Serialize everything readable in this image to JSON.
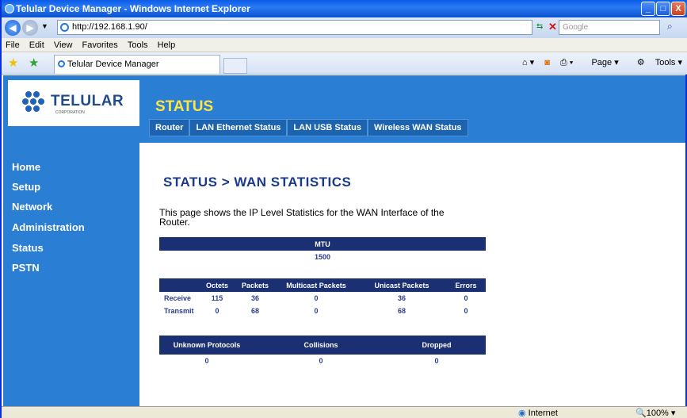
{
  "window": {
    "title": "Telular Device Manager - Windows Internet Explorer",
    "address": "http://192.168.1.90/",
    "search_placeholder": "Google",
    "tab_label": "Telular Device Manager"
  },
  "menu": [
    "File",
    "Edit",
    "View",
    "Favorites",
    "Tools",
    "Help"
  ],
  "toolbar": {
    "page_label": "Page",
    "tools_label": "Tools"
  },
  "logo": {
    "name": "TELULAR",
    "sub": "CORPORATION"
  },
  "page": {
    "section_title": "STATUS",
    "heading": "STATUS > WAN STATISTICS",
    "description": "This page shows the IP Level Statistics for the WAN Interface of the Router."
  },
  "nav_tabs": [
    "Router",
    "LAN Ethernet Status",
    "LAN USB Status",
    "Wireless WAN Status"
  ],
  "sidebar": [
    "Home",
    "Setup",
    "Network",
    "Administration",
    "Status",
    "PSTN"
  ],
  "mtu": {
    "header": "MTU",
    "value": "1500"
  },
  "traffic": {
    "headers": [
      "Octets",
      "Packets",
      "Multicast Packets",
      "Unicast Packets",
      "Errors"
    ],
    "rows": [
      {
        "label": "Receive",
        "values": [
          "115",
          "36",
          "0",
          "36",
          "0"
        ]
      },
      {
        "label": "Transmit",
        "values": [
          "0",
          "68",
          "0",
          "68",
          "0"
        ]
      }
    ]
  },
  "misc": {
    "headers": [
      "Unknown Protocols",
      "Collisions",
      "Dropped"
    ],
    "values": [
      "0",
      "0",
      "0"
    ]
  },
  "status_bar": {
    "zone": "Internet",
    "zoom": "100%"
  }
}
